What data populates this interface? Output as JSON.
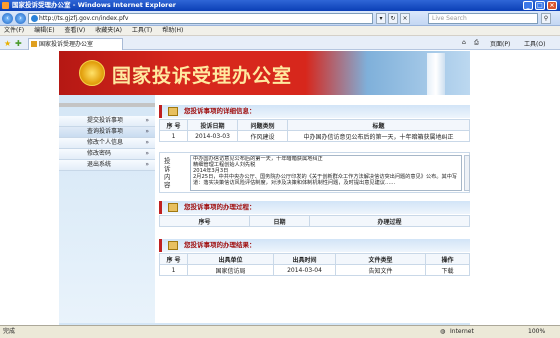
{
  "window": {
    "title": "国家投诉受理办公室 - Windows Internet Explorer",
    "minimize": "_",
    "maximize": "□",
    "close": "×"
  },
  "browser": {
    "address": "http://ts.gjzfj.gov.cn/index.pfv",
    "search_placeholder": "Live Search",
    "menu": [
      "文件(F)",
      "编辑(E)",
      "查看(V)",
      "收藏夹(A)",
      "工具(T)",
      "帮助(H)"
    ],
    "tab_title": "国家投诉受理办公室",
    "page_menu": "页面(P)",
    "tools_menu": "工具(O)"
  },
  "site": {
    "banner_title": "国家投诉受理办公室"
  },
  "nav": {
    "items": [
      "提交投诉事项",
      "查询投诉事项",
      "修改个人信息",
      "修改密码",
      "退出系统"
    ],
    "arrow": "»"
  },
  "detail": {
    "heading": "您投诉事项的详细信息：",
    "columns": [
      "序 号",
      "投诉日期",
      "问题类别",
      "标题"
    ],
    "row": [
      "1",
      "2014-03-03",
      "作风建设",
      "中办国办信访意见公布后的第一天，十年暗箱获属地纠正"
    ],
    "content_label": "投诉内容",
    "content_lines": [
      "中办国办信访意见公布后的第一天，十年暗箱获属地纠正",
      "精细管理工程创始人刘先税",
      "2014年3月3日",
      "2月25日，中共中央办公厅、国务院办公厅印发的《关于创新群众工作方法解决信访突出问题的意见》公布。其中写道：落实决策信访风险评估制度，对涉及决策和体制机制性问题，及时提出意见建议……"
    ]
  },
  "process": {
    "heading": "您投诉事项的办理过程：",
    "columns": [
      "序号",
      "日期",
      "办理过程"
    ]
  },
  "result": {
    "heading": "您投诉事项的办理结果：",
    "columns": [
      "序 号",
      "出具单位",
      "出具时间",
      "文件类型",
      "操作"
    ],
    "row": [
      "1",
      "国家信访局",
      "2014-03-04",
      "告知文件",
      "下载"
    ]
  },
  "status": {
    "left": "完成",
    "zone": "Internet",
    "zoom": "100%"
  }
}
